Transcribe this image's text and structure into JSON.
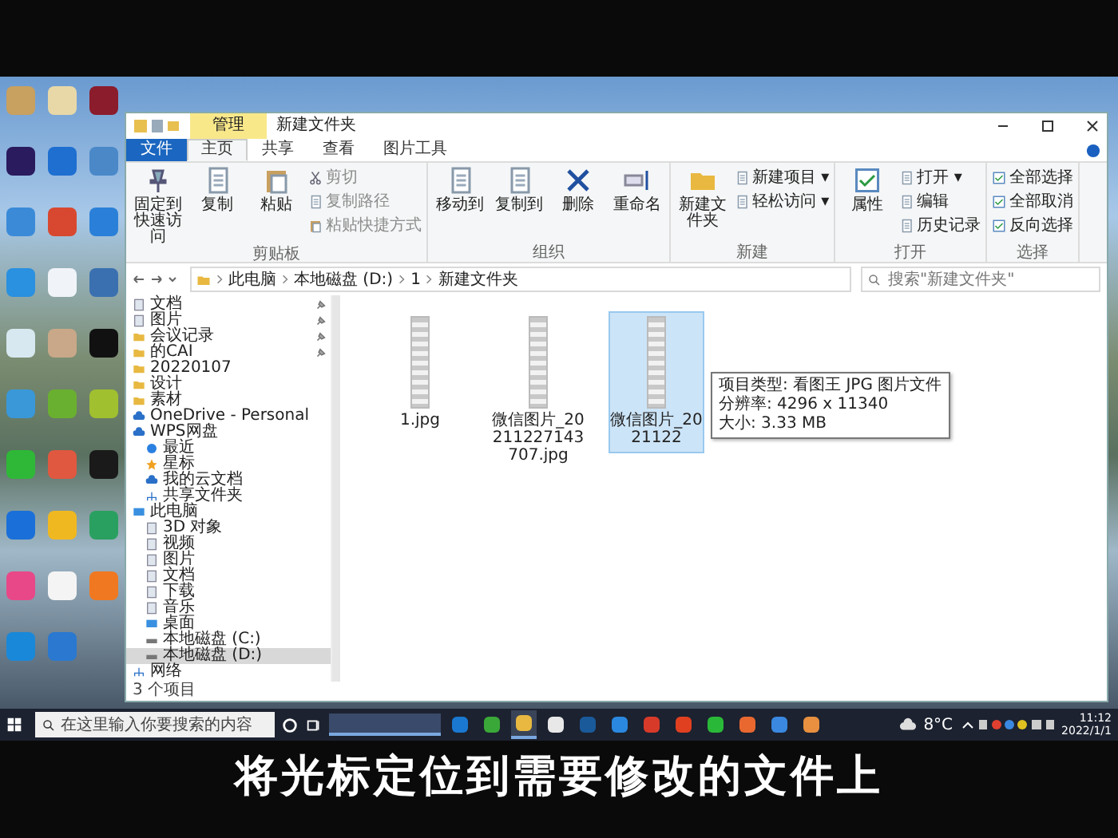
{
  "desktop_icons": [
    {
      "color": "#c8a060"
    },
    {
      "color": "#e8d8a8"
    },
    {
      "color": "#8a1c2c"
    },
    {
      "color": "#2a1a5e"
    },
    {
      "color": "#1e6fd0"
    },
    {
      "color": "#4a88c8"
    },
    {
      "color": "#3a8ad8"
    },
    {
      "color": "#d84830"
    },
    {
      "color": "#2a80d8"
    },
    {
      "color": "#2a90e0"
    },
    {
      "color": "#f0f4f8"
    },
    {
      "color": "#3a70b0"
    },
    {
      "color": "#d8e8f0"
    },
    {
      "color": "#c8a888"
    },
    {
      "color": "#111111"
    },
    {
      "color": "#3a98d8"
    },
    {
      "color": "#6ab030"
    },
    {
      "color": "#a0c030"
    },
    {
      "color": "#2fb838"
    },
    {
      "color": "#e05840"
    },
    {
      "color": "#1a1a1a"
    },
    {
      "color": "#1a70d8"
    },
    {
      "color": "#f0b820"
    },
    {
      "color": "#2aa060"
    },
    {
      "color": "#e84888"
    },
    {
      "color": "#f4f4f4"
    },
    {
      "color": "#f07820"
    },
    {
      "color": "#1a88d8"
    },
    {
      "color": "#2a78d0"
    }
  ],
  "explorer": {
    "title": "新建文件夹",
    "context_tab": "管理",
    "tabs": [
      {
        "label": "文件",
        "selected": false,
        "kind": "file"
      },
      {
        "label": "主页",
        "selected": true,
        "kind": "plain"
      },
      {
        "label": "共享",
        "selected": false,
        "kind": "plain"
      },
      {
        "label": "查看",
        "selected": false,
        "kind": "plain"
      },
      {
        "label": "图片工具",
        "selected": false,
        "kind": "plain"
      }
    ],
    "ribbon_groups": [
      {
        "label": "剪贴板",
        "columns": [
          [
            {
              "label": "固定到快速访问",
              "kind": "pin",
              "disabled": false
            }
          ],
          [
            {
              "label": "复制",
              "kind": "copy",
              "disabled": false
            }
          ],
          [
            {
              "label": "粘贴",
              "kind": "paste",
              "disabled": false
            }
          ],
          [
            {
              "label": "剪切",
              "kind": "cut",
              "disabled": true
            },
            {
              "label": "复制路径",
              "kind": "copy",
              "disabled": true
            },
            {
              "label": "粘贴快捷方式",
              "kind": "paste",
              "disabled": true
            }
          ]
        ]
      },
      {
        "label": "组织",
        "columns": [
          [
            {
              "label": "移动到",
              "kind": "copy",
              "disabled": false
            }
          ],
          [
            {
              "label": "复制到",
              "kind": "copy",
              "disabled": false
            }
          ],
          [
            {
              "label": "删除",
              "kind": "delete",
              "disabled": false
            }
          ],
          [
            {
              "label": "重命名",
              "kind": "rename",
              "disabled": false
            }
          ]
        ]
      },
      {
        "label": "新建",
        "columns": [
          [
            {
              "label": "新建文件夹",
              "kind": "folder",
              "disabled": false
            }
          ],
          [
            {
              "label": "新建项目 ▾",
              "kind": "copy",
              "disabled": false
            },
            {
              "label": "轻松访问 ▾",
              "kind": "copy",
              "disabled": false
            }
          ]
        ]
      },
      {
        "label": "打开",
        "columns": [
          [
            {
              "label": "属性",
              "kind": "check",
              "disabled": false
            }
          ],
          [
            {
              "label": "打开 ▾",
              "kind": "copy",
              "disabled": false
            },
            {
              "label": "编辑",
              "kind": "copy",
              "disabled": false
            },
            {
              "label": "历史记录",
              "kind": "copy",
              "disabled": false
            }
          ]
        ]
      },
      {
        "label": "选择",
        "columns": [
          [
            {
              "label": "全部选择",
              "kind": "check",
              "disabled": false
            },
            {
              "label": "全部取消",
              "kind": "check",
              "disabled": false
            },
            {
              "label": "反向选择",
              "kind": "check",
              "disabled": false
            }
          ]
        ]
      }
    ],
    "path": [
      "此电脑",
      "本地磁盘 (D:)",
      "1",
      "新建文件夹"
    ],
    "search": {
      "placeholder": "搜索\"新建文件夹\""
    },
    "nav": [
      {
        "label": "文档",
        "kind": "doc",
        "pinned": true,
        "selected": false
      },
      {
        "label": "图片",
        "kind": "doc",
        "pinned": true,
        "selected": false
      },
      {
        "label": "会议记录",
        "kind": "folder",
        "pinned": true,
        "selected": false
      },
      {
        "label": "的CAI",
        "kind": "folder",
        "pinned": true,
        "selected": false
      },
      {
        "label": "20220107",
        "kind": "folder",
        "pinned": false,
        "selected": false
      },
      {
        "label": "设计",
        "kind": "folder",
        "pinned": false,
        "selected": false
      },
      {
        "label": "素材",
        "kind": "folder",
        "pinned": false,
        "selected": false
      },
      {
        "label": "OneDrive - Personal",
        "kind": "cloud",
        "pinned": false,
        "selected": false
      },
      {
        "label": "WPS网盘",
        "kind": "cloud",
        "pinned": false,
        "selected": false,
        "children": [
          {
            "label": "最近",
            "kind": "clock",
            "pinned": false,
            "selected": false
          },
          {
            "label": "星标",
            "kind": "star",
            "pinned": false,
            "selected": false
          },
          {
            "label": "我的云文档",
            "kind": "cloud",
            "pinned": false,
            "selected": false
          },
          {
            "label": "共享文件夹",
            "kind": "network",
            "pinned": false,
            "selected": false
          }
        ]
      },
      {
        "label": "此电脑",
        "kind": "pc",
        "pinned": false,
        "selected": false,
        "children": [
          {
            "label": "3D 对象",
            "kind": "doc",
            "pinned": false,
            "selected": false
          },
          {
            "label": "视频",
            "kind": "doc",
            "pinned": false,
            "selected": false
          },
          {
            "label": "图片",
            "kind": "doc",
            "pinned": false,
            "selected": false
          },
          {
            "label": "文档",
            "kind": "doc",
            "pinned": false,
            "selected": false
          },
          {
            "label": "下载",
            "kind": "doc",
            "pinned": false,
            "selected": false
          },
          {
            "label": "音乐",
            "kind": "doc",
            "pinned": false,
            "selected": false
          },
          {
            "label": "桌面",
            "kind": "pc",
            "pinned": false,
            "selected": false
          },
          {
            "label": "本地磁盘 (C:)",
            "kind": "drive",
            "pinned": false,
            "selected": false
          },
          {
            "label": "本地磁盘 (D:)",
            "kind": "drive",
            "pinned": false,
            "selected": true
          }
        ]
      },
      {
        "label": "网络",
        "kind": "network",
        "pinned": false,
        "selected": false
      }
    ],
    "files": [
      {
        "name": "1.jpg",
        "selected": false
      },
      {
        "name": "微信图片_20211227143707.jpg",
        "selected": false
      },
      {
        "name": "微信图片_2021122",
        "selected": true
      }
    ],
    "tooltip": [
      "项目类型: 看图王 JPG 图片文件",
      "分辨率: 4296 x 11340",
      "大小: 3.33 MB"
    ],
    "status": "3 个项目"
  },
  "taskbar": {
    "search": {
      "placeholder": "在这里输入你要搜索的内容"
    },
    "apps": [
      {
        "color": "#1a78d0",
        "selected": false
      },
      {
        "color": "#3aa838",
        "selected": false
      },
      {
        "color": "#e8b840",
        "selected": true
      },
      {
        "color": "#e8e8e8",
        "selected": false
      },
      {
        "color": "#1a5a9a",
        "selected": false
      },
      {
        "color": "#2a88e0",
        "selected": false
      },
      {
        "color": "#d83a2a",
        "selected": false
      },
      {
        "color": "#e04020",
        "selected": false
      },
      {
        "color": "#2ab838",
        "selected": false
      },
      {
        "color": "#e86830",
        "selected": false
      },
      {
        "color": "#3a88e0",
        "selected": false
      },
      {
        "color": "#e89040",
        "selected": false
      }
    ],
    "temperature": "8°C",
    "time": "11:12",
    "date": "2022/1/1"
  },
  "caption": "将光标定位到需要修改的文件上"
}
